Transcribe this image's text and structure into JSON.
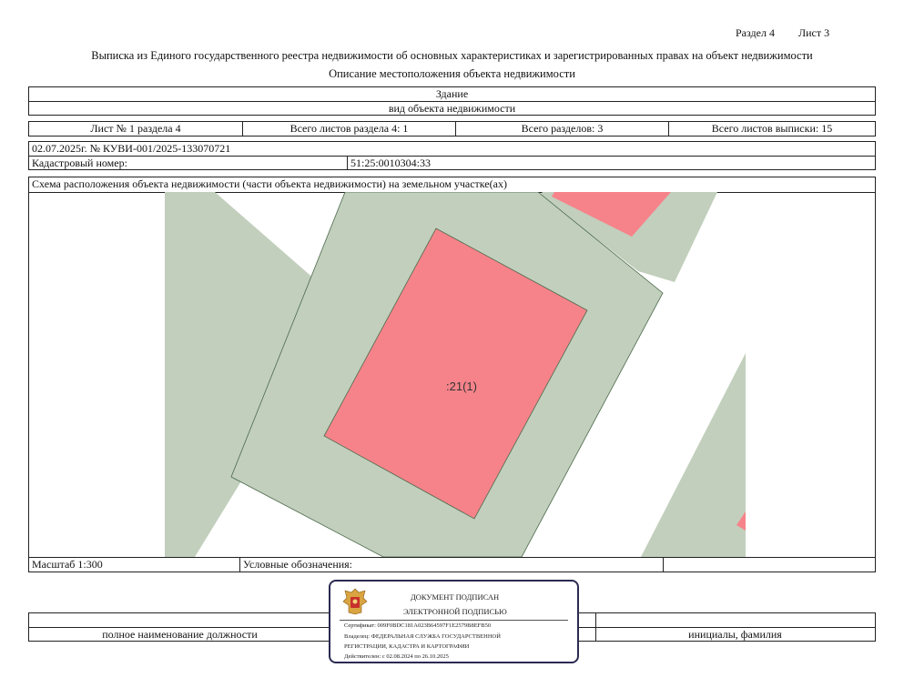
{
  "header": {
    "section": "Раздел 4",
    "sheet": "Лист 3",
    "title": "Выписка из Единого государственного реестра недвижимости об основных характеристиках и зарегистрированных правах на объект недвижимости",
    "subtitle": "Описание местоположения объекта недвижимости"
  },
  "object": {
    "type_value": "Здание",
    "type_label": "вид объекта недвижимости"
  },
  "counts": {
    "sheet_no": "Лист № 1 раздела 4",
    "sheets_in_section": "Всего листов раздела 4: 1",
    "sections_total": "Всего разделов: 3",
    "sheets_total": "Всего листов выписки: 15"
  },
  "record": {
    "date_number": "02.07.2025г. № КУВИ-001/2025-133070721",
    "cadastral_label": "Кадастровый номер:",
    "cadastral_value": "51:25:0010304:33"
  },
  "scheme": {
    "title": "Схема расположения объекта недвижимости (части объекта недвижимости) на земельном участке(ах)",
    "building_label": ":21(1)",
    "colors": {
      "parcel": "#c2cfbd",
      "building": "#f6838a",
      "outline": "#4a6a4a"
    }
  },
  "footer": {
    "scale": "Масштаб 1:300",
    "legend": "Условные обозначения:",
    "position_caption": "полное наименование должности",
    "initials_caption": "инициалы, фамилия"
  },
  "stamp": {
    "emblem": "emblem-icon",
    "line1": "ДОКУМЕНТ ПОДПИСАН",
    "line2": "ЭЛЕКТРОННОЙ ПОДПИСЬЮ",
    "cert": "Сертификат: 009F0BDC181A023B64597F1E2579B8EFB50",
    "owner1": "Владелец: ФЕДЕРАЛЬНАЯ СЛУЖБА ГОСУДАРСТВЕННОЙ",
    "owner2": "РЕГИСТРАЦИИ, КАДАСТРА И КАРТОГРАФИИ",
    "valid": "Действителен: с 02.08.2024 по 26.10.2025"
  }
}
